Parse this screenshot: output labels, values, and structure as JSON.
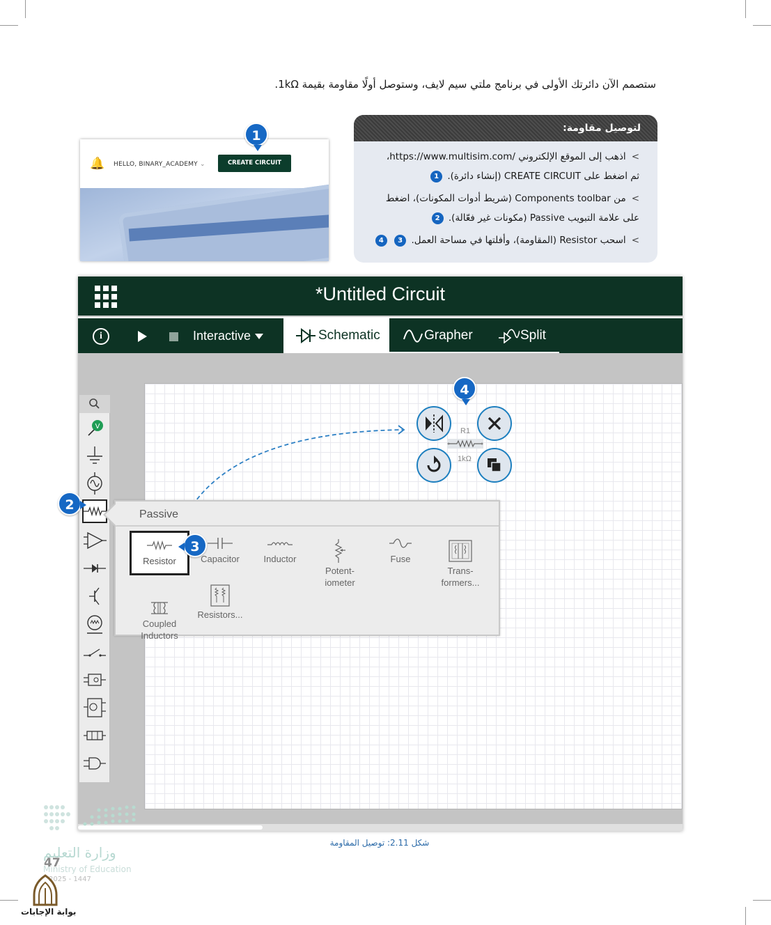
{
  "intro_text": "ستصمم الآن دائرتك الأولى في برنامج ملتي سيم لايف، وستوصل أولًا مقاومة بقيمة 1kΩ.",
  "instructions": {
    "title": "لتوصيل مقاومة:",
    "steps": [
      {
        "bullet": ">",
        "line1": "اذهب إلى الموقع الإلكتروني /https://www.multisim.com،",
        "line2": "ثم اضغط على CREATE CIRCUIT (إنشاء دائرة).",
        "badges": [
          "1"
        ]
      },
      {
        "bullet": ">",
        "line1": "من Components toolbar (شريط أدوات المكونات)، اضغط",
        "line2": "على علامة التبويب Passive (مكونات غير فعّالة).",
        "badges": [
          "2"
        ]
      },
      {
        "bullet": ">",
        "line1": "اسحب Resistor (المقاومة)، وأفلتها في مساحة العمل.",
        "line2": "",
        "badges": [
          "3",
          "4"
        ]
      }
    ]
  },
  "website": {
    "greeting": "HELLO, BINARY_ACADEMY",
    "greeting_caret": "⌄",
    "create_button": "CREATE CIRCUIT"
  },
  "badges": {
    "b1": "1",
    "b2": "2",
    "b3": "3",
    "b4": "4"
  },
  "app": {
    "title": "*Untitled Circuit",
    "info_glyph": "i",
    "mode_label": "Interactive",
    "tabs": [
      {
        "label": "Schematic",
        "active": true
      },
      {
        "label": "Grapher",
        "active": false
      },
      {
        "label": "Split",
        "active": false
      }
    ],
    "sidebar_icons": [
      "search-icon",
      "voltage-probe-icon",
      "ground-icon",
      "ac-source-icon",
      "passive-icon",
      "amplifier-icon",
      "diode-icon",
      "transistor-icon",
      "lamp-icon",
      "switch-icon",
      "logic-icon",
      "mixed-icon",
      "connector-icon",
      "digital-gate-icon"
    ],
    "probe_letter": "V",
    "passive_panel": {
      "title": "Passive",
      "components": [
        {
          "label": "Resistor",
          "icon": "resistor-icon",
          "active": true
        },
        {
          "label": "Capacitor",
          "icon": "capacitor-icon"
        },
        {
          "label": "Inductor",
          "icon": "inductor-icon"
        },
        {
          "label": "Potent-\niometer",
          "icon": "potentiometer-icon"
        },
        {
          "label": "Fuse",
          "icon": "fuse-icon"
        },
        {
          "label": "Trans-\nformers...",
          "icon": "transformer-icon"
        },
        {
          "label": "Coupled\nInductors",
          "icon": "coupled-inductors-icon"
        },
        {
          "label": "Resistors...",
          "icon": "resistor-network-icon"
        }
      ]
    },
    "placed_resistor": {
      "ref": "R1",
      "value": "1kΩ"
    }
  },
  "caption": "شكل 2.11: توصيل المقاومة",
  "footer": {
    "ministry_ar": "وزارة التعليم",
    "ministry_en": "Ministry of Education",
    "page_number": "47",
    "year": "2025 - 1447",
    "portal": "بوابة الإجابات"
  },
  "colors": {
    "app_dark_green": "#0d3324",
    "badge_blue": "#1668c4",
    "accent_blue": "#1d7fbf"
  }
}
